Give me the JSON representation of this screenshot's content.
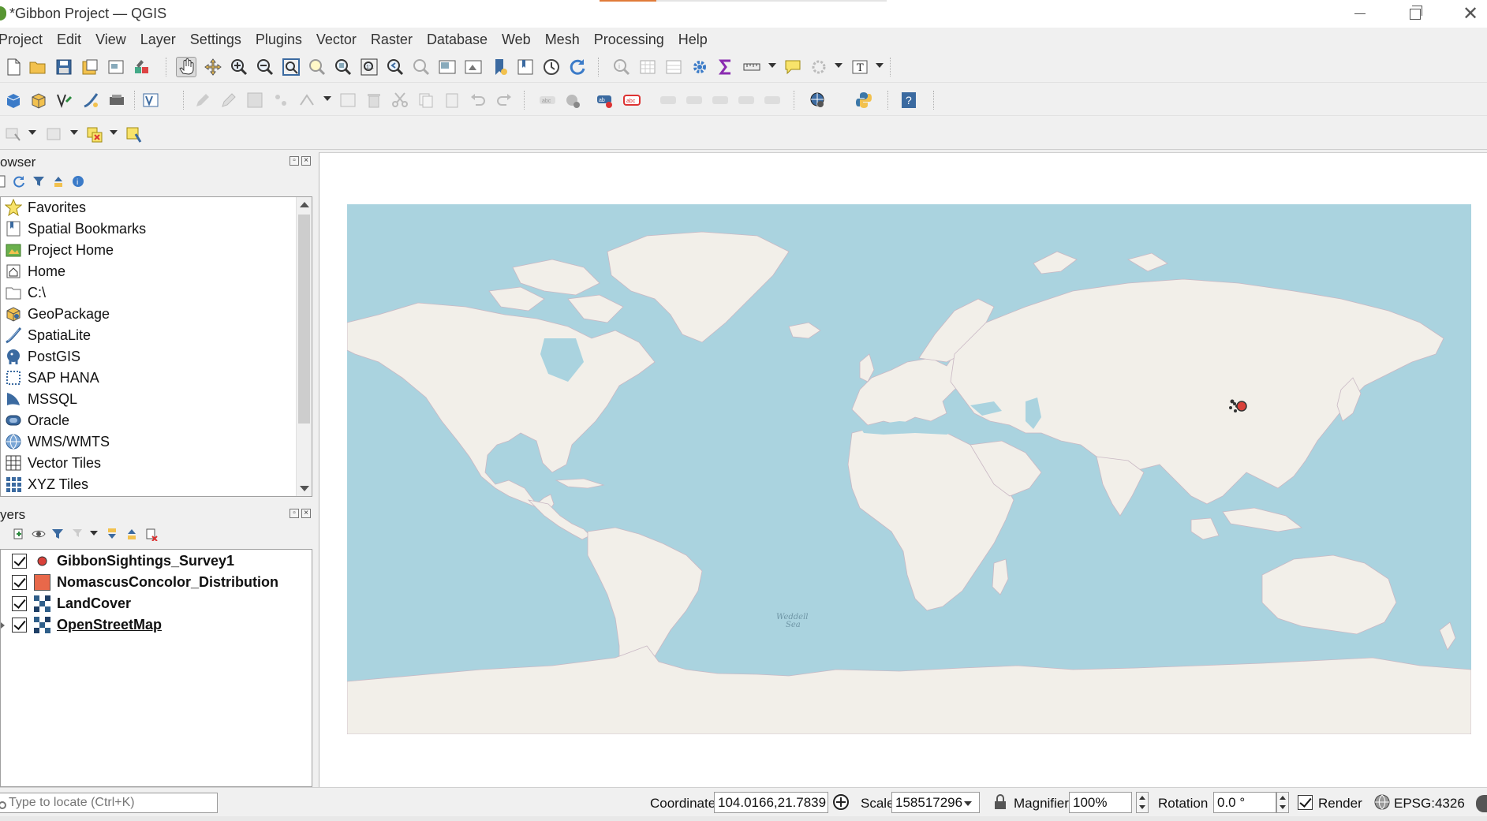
{
  "window": {
    "title": "*Gibbon Project — QGIS"
  },
  "menu": [
    {
      "label": "Project"
    },
    {
      "label": "Edit"
    },
    {
      "label": "View"
    },
    {
      "label": "Layer"
    },
    {
      "label": "Settings"
    },
    {
      "label": "Plugins"
    },
    {
      "label": "Vector"
    },
    {
      "label": "Raster"
    },
    {
      "label": "Database"
    },
    {
      "label": "Web"
    },
    {
      "label": "Mesh"
    },
    {
      "label": "Processing"
    },
    {
      "label": "Help"
    }
  ],
  "browser": {
    "title": "owser",
    "items": [
      {
        "label": "Favorites",
        "icon": "star-icon"
      },
      {
        "label": "Spatial Bookmarks",
        "icon": "bookmark-icon"
      },
      {
        "label": "Project Home",
        "icon": "project-home-icon"
      },
      {
        "label": "Home",
        "icon": "home-icon"
      },
      {
        "label": "C:\\",
        "icon": "folder-icon"
      },
      {
        "label": "GeoPackage",
        "icon": "geopackage-icon"
      },
      {
        "label": "SpatiaLite",
        "icon": "spatialite-icon"
      },
      {
        "label": "PostGIS",
        "icon": "postgis-icon"
      },
      {
        "label": "SAP HANA",
        "icon": "sap-hana-icon"
      },
      {
        "label": "MSSQL",
        "icon": "mssql-icon"
      },
      {
        "label": "Oracle",
        "icon": "oracle-icon"
      },
      {
        "label": "WMS/WMTS",
        "icon": "globe-icon"
      },
      {
        "label": "Vector Tiles",
        "icon": "vector-tiles-icon"
      },
      {
        "label": "XYZ Tiles",
        "icon": "xyz-tiles-icon"
      }
    ]
  },
  "layers": {
    "title": "yers",
    "items": [
      {
        "label": "GibbonSightings_Survey1",
        "checked": true,
        "symbol": "point-icon",
        "color": "#d9413a"
      },
      {
        "label": "NomascusConcolor_Distribution",
        "checked": true,
        "symbol": "polygon-icon",
        "color": "#e8684a"
      },
      {
        "label": "LandCover",
        "checked": true,
        "symbol": "raster-icon",
        "color": "#2f5f8a"
      },
      {
        "label": "OpenStreetMap",
        "checked": true,
        "symbol": "raster-icon",
        "color": "#2f5f8a"
      }
    ]
  },
  "map": {
    "ocean_color": "#aad3df",
    "land_color": "#f2efe9",
    "sea_label_line1": "Weddell",
    "sea_label_line2": "Sea"
  },
  "status": {
    "locator_placeholder": "Type to locate (Ctrl+K)",
    "coordinate_label": "Coordinate",
    "coordinate_value": "104.0166,21.7839",
    "scale_label": "Scale",
    "scale_value": "158517296",
    "magnifier_label": "Magnifier",
    "magnifier_value": "100%",
    "rotation_label": "Rotation",
    "rotation_value": "0.0 °",
    "render_label": "Render",
    "crs_label": "EPSG:4326"
  },
  "colors": {
    "accent": "#e07b39",
    "qgis_green": "#589632"
  }
}
